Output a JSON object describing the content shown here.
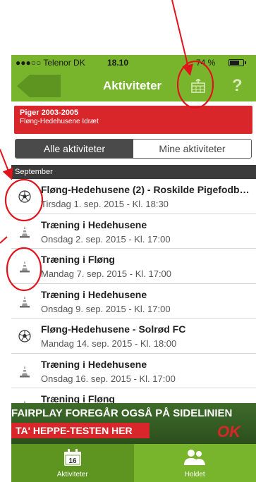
{
  "status_bar": {
    "carrier": "●●●○○ Telenor DK",
    "time": "18.10",
    "battery": "74 %"
  },
  "nav": {
    "title": "Aktiviteter",
    "help": "?",
    "back_icon": "back-arrow-icon",
    "export_icon": "calendar-export-icon"
  },
  "team": {
    "name": "Piger 2003-2005",
    "club": "Fløng-Hedehusene Idræt"
  },
  "segments": {
    "all": "Alle aktiviteter",
    "mine": "Mine aktiviteter",
    "selected": "all"
  },
  "month": "September",
  "activities": [
    {
      "type": "match",
      "title": "Fløng-Hedehusene (2) - Roskilde Pigefodbold",
      "when": "Tirsdag 1. sep. 2015 - Kl. 18:30"
    },
    {
      "type": "training",
      "title": "Træning i Hedehusene",
      "when": "Onsdag 2. sep. 2015 - Kl. 17:00"
    },
    {
      "type": "training",
      "title": "Træning i Fløng",
      "when": "Mandag 7. sep. 2015 - Kl. 17:00"
    },
    {
      "type": "training",
      "title": "Træning i Hedehusene",
      "when": "Onsdag 9. sep. 2015 - Kl. 17:00"
    },
    {
      "type": "match",
      "title": "Fløng-Hedehusene - Solrød FC",
      "when": "Mandag 14. sep. 2015 - Kl. 18:00"
    },
    {
      "type": "training",
      "title": "Træning i Hedehusene",
      "when": "Onsdag 16. sep. 2015 - Kl. 17:00"
    },
    {
      "type": "training",
      "title": "Træning i Fløng",
      "when": ""
    }
  ],
  "ad": {
    "line1": "FAIRPLAY FOREGÅR OGSÅ PÅ SIDELINIEN",
    "line2": "TA' HEPPE-TESTEN HER",
    "logo": "OK"
  },
  "tabs": [
    {
      "label": "Aktiviteter",
      "icon": "calendar-icon",
      "badge": "16",
      "selected": true
    },
    {
      "label": "Holdet",
      "icon": "people-icon",
      "selected": false
    }
  ],
  "colors": {
    "brand_green": "#78b52c",
    "dark_green": "#5e9521",
    "team_red": "#d9262b",
    "annotation_red": "#e0141c"
  },
  "battery_level": 0.74
}
